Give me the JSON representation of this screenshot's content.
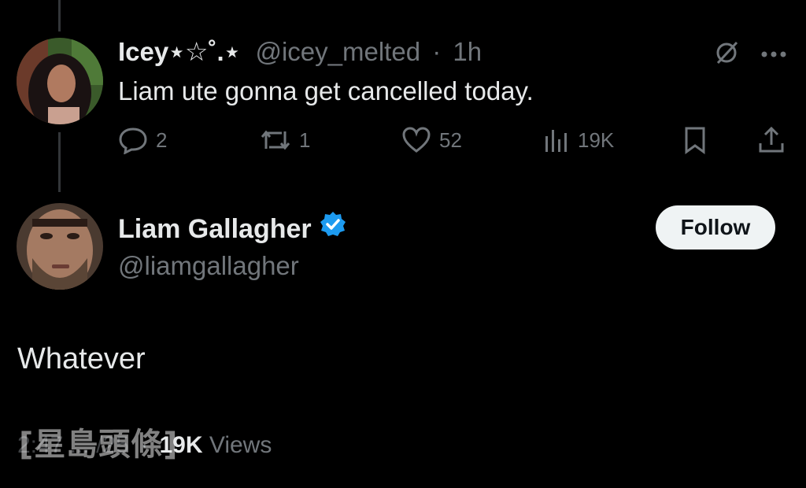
{
  "tweet1": {
    "display_name": "Icey⋆☆˚.⋆",
    "handle": "@icey_melted",
    "separator": "·",
    "time": "1h",
    "text": "Liam ute gonna get cancelled today.",
    "actions": {
      "replies": "2",
      "reposts": "1",
      "likes": "52",
      "views": "19K"
    }
  },
  "tweet2": {
    "display_name": "Liam Gallagher",
    "handle": "@liamgallagher",
    "follow_label": "Follow",
    "text": "Whatever",
    "date_partial": "2:47 ... /25",
    "separator": "·",
    "views_count": "19K",
    "views_label": "Views"
  },
  "watermark": "[星島頭條]",
  "colors": {
    "background": "#000000",
    "text": "#e7e9ea",
    "muted": "#71767b",
    "verified": "#1d9bf0",
    "follow_bg": "#eff3f4"
  }
}
